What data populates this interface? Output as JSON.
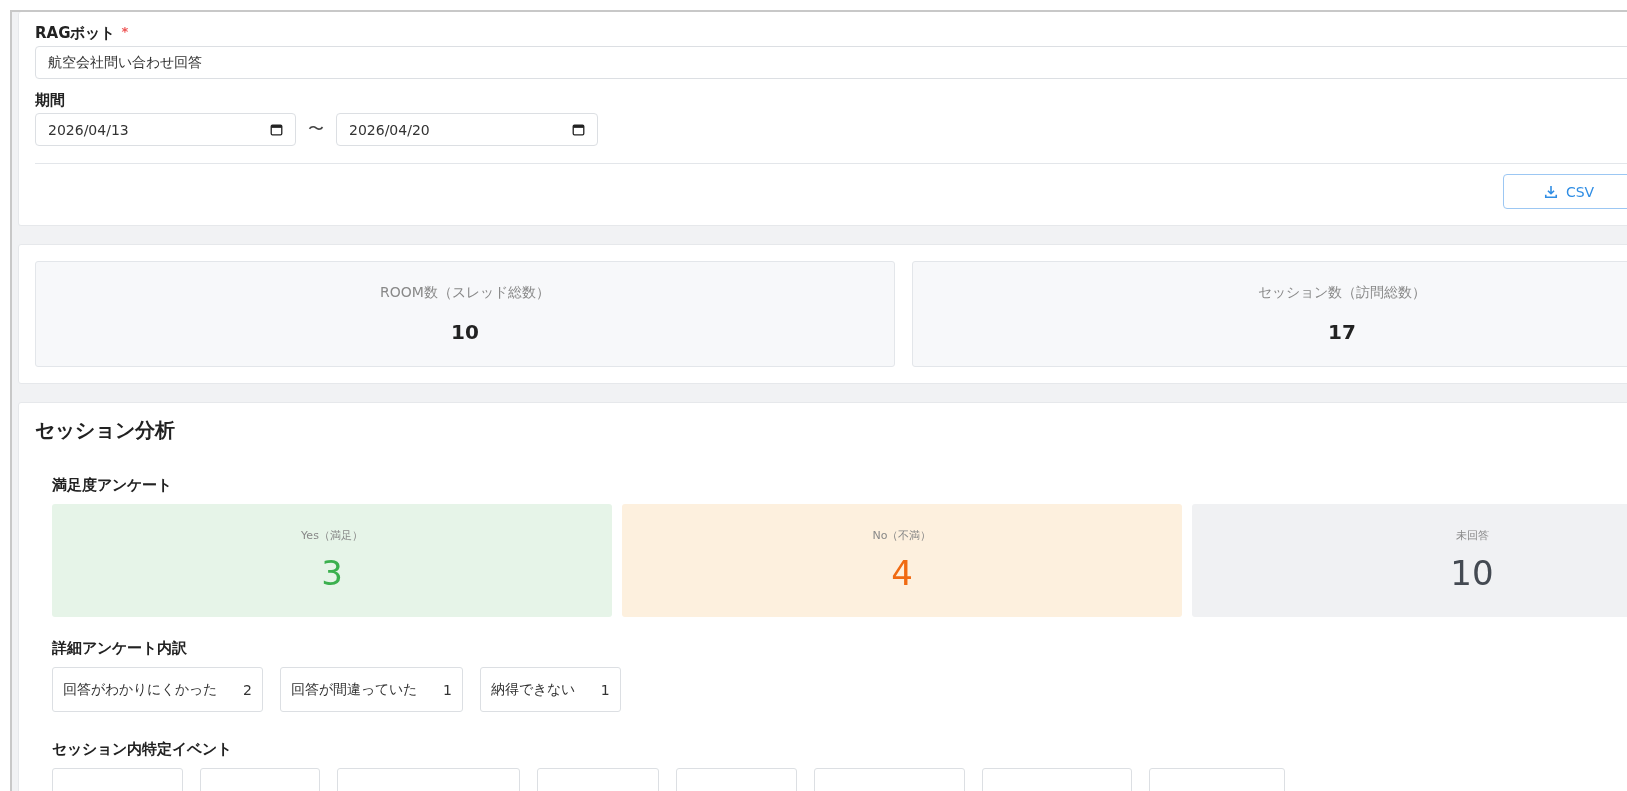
{
  "filter": {
    "bot_label": "RAGボット",
    "required_mark": "*",
    "bot_value": "航空会社問い合わせ回答",
    "period_label": "期間",
    "date_from": "2026/04/13",
    "separator": "〜",
    "date_to": "2026/04/20",
    "csv_button": "CSV"
  },
  "stats": [
    {
      "label": "ROOM数（スレッド総数）",
      "value": "10"
    },
    {
      "label": "セッション数（訪問総数）",
      "value": "17"
    }
  ],
  "session_analysis": {
    "title": "セッション分析",
    "survey_title": "満足度アンケート",
    "survey": [
      {
        "kind": "yes",
        "label": "Yes（満足）",
        "value": "3"
      },
      {
        "kind": "no",
        "label": "No（不満）",
        "value": "4"
      },
      {
        "kind": "none",
        "label": "未回答",
        "value": "10"
      }
    ],
    "detail_title": "詳細アンケート内訳",
    "details": [
      {
        "label": "回答がわかりにくかった",
        "count": "2"
      },
      {
        "label": "回答が間違っていた",
        "count": "1"
      },
      {
        "label": "納得できない",
        "count": "1"
      }
    ],
    "events_title": "セッション内特定イベント"
  }
}
